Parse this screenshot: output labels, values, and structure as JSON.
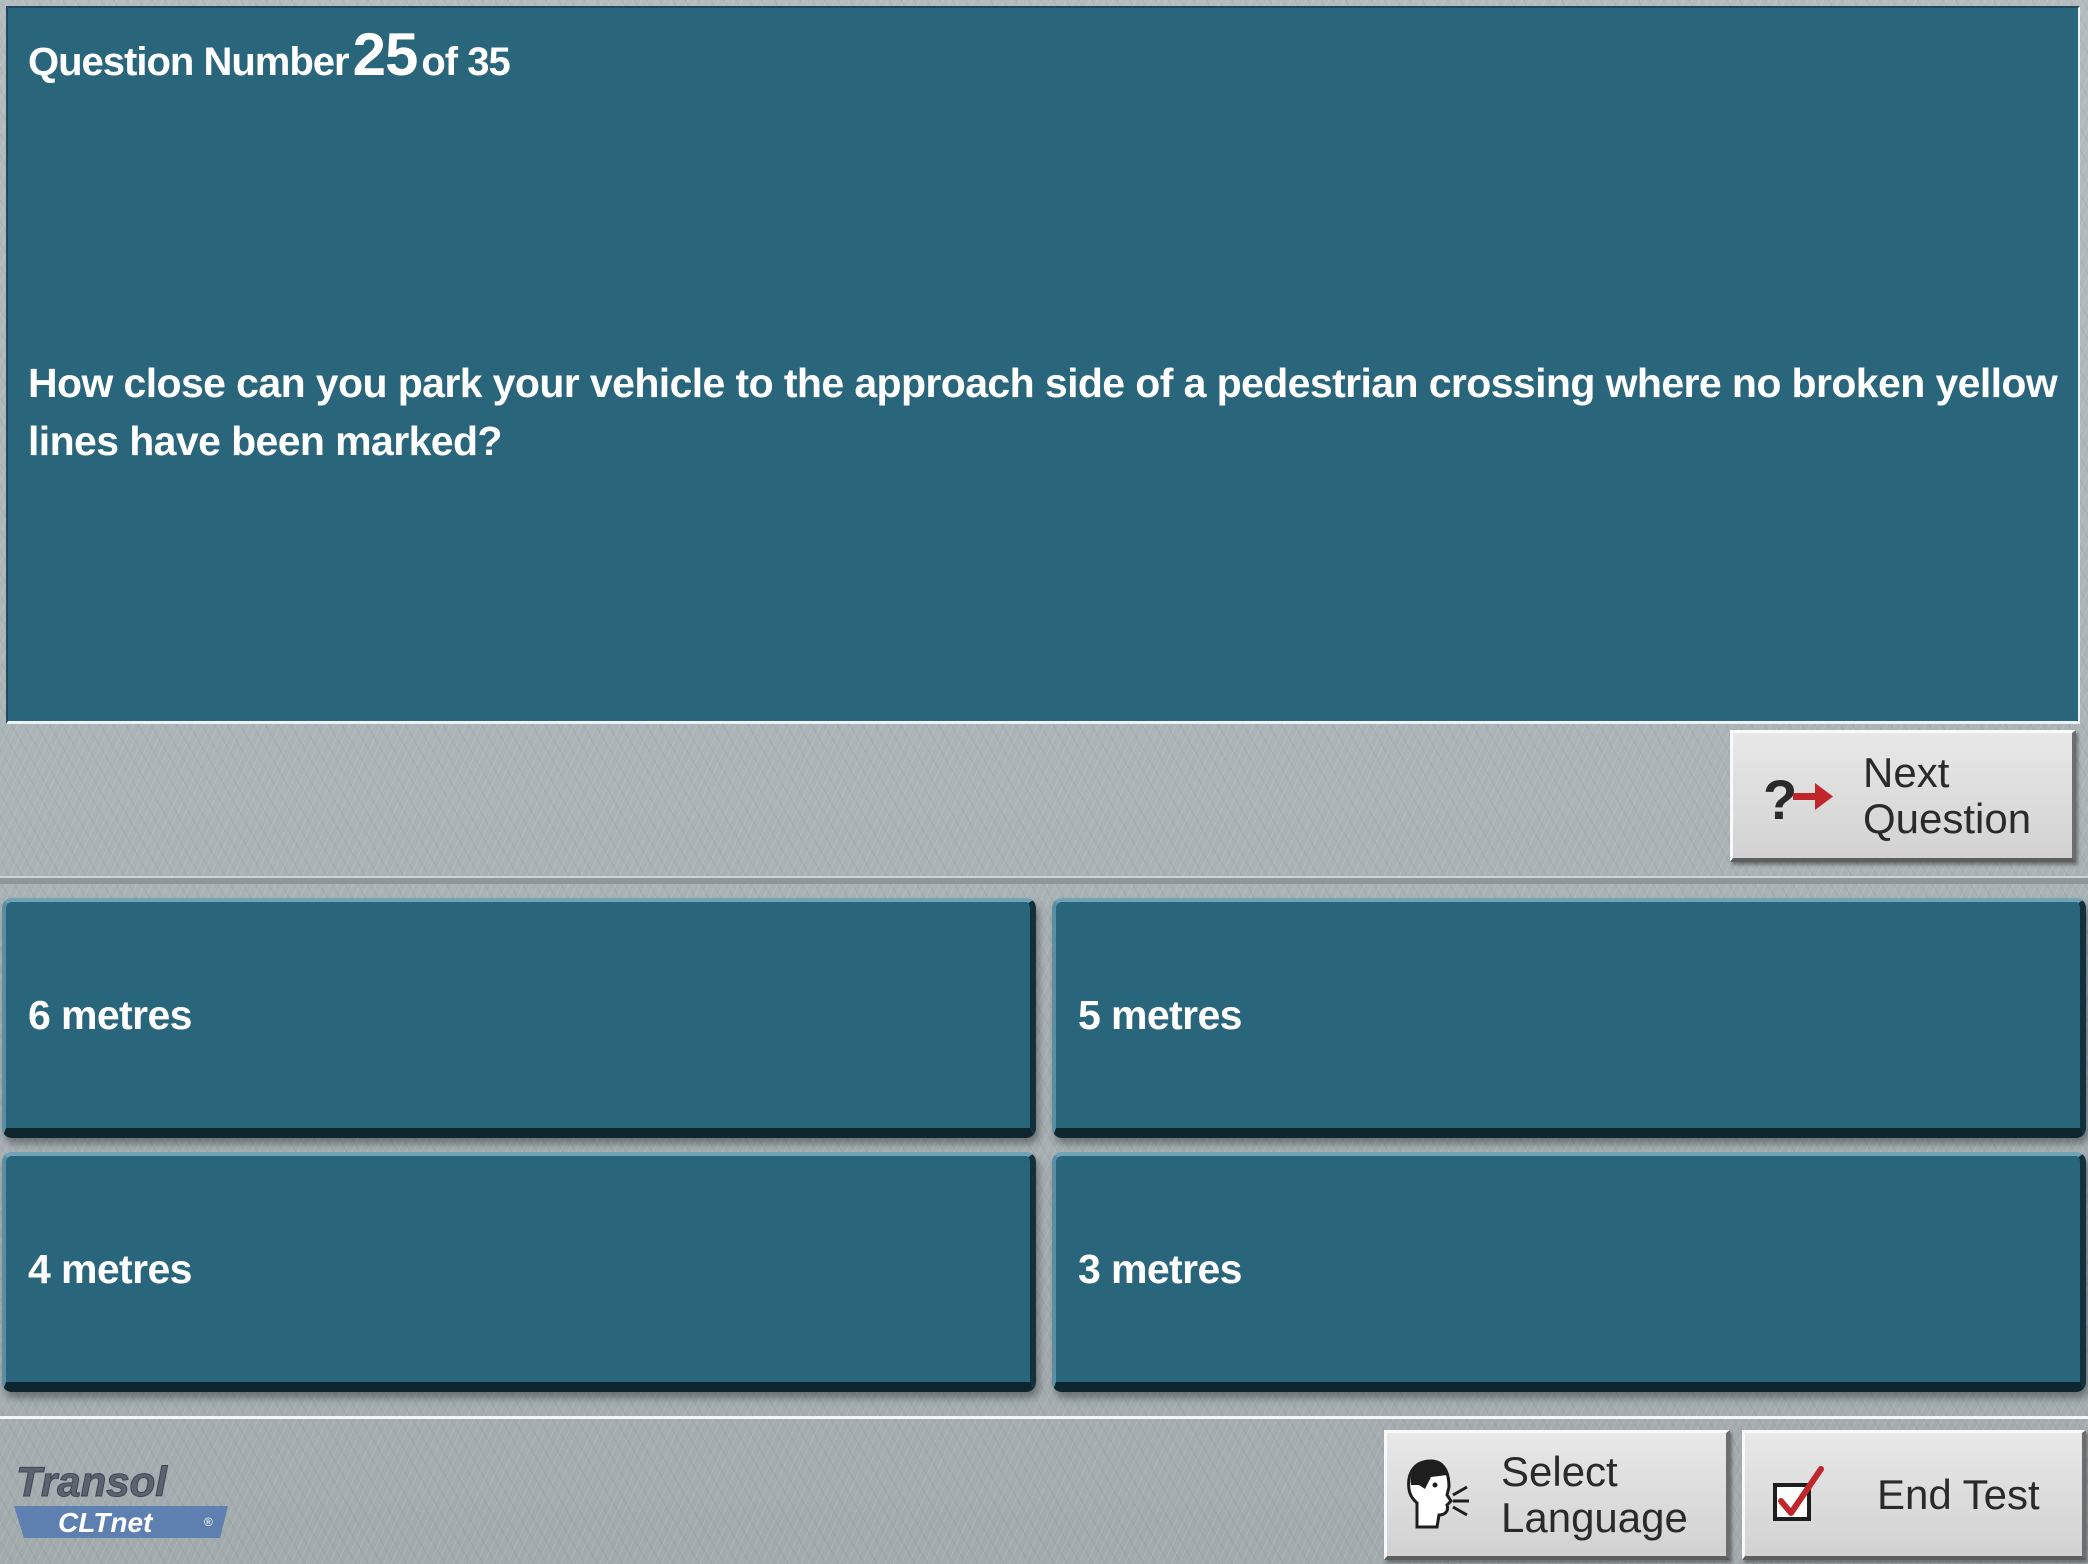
{
  "question": {
    "header_prefix": "Question Number",
    "number": "25",
    "header_suffix": "of 35",
    "text": "How close can you park your vehicle to the approach side of a pedestrian crossing where no broken yellow lines have been marked?"
  },
  "buttons": {
    "next_line1": "Next",
    "next_line2": "Question",
    "next_icon": "question-arrow-icon",
    "select_language_line1": "Select",
    "select_language_line2": "Language",
    "select_language_icon": "speaking-head-icon",
    "end_test": "End Test",
    "end_test_icon": "checkbox-check-icon"
  },
  "answers": [
    {
      "label": "6 metres"
    },
    {
      "label": "5 metres"
    },
    {
      "label": "4 metres"
    },
    {
      "label": "3 metres"
    }
  ],
  "logo": {
    "line1": "Transol",
    "line2": "CLTnet"
  },
  "colors": {
    "panel": "#29657b",
    "accent_red": "#c0272d",
    "logo_blue": "#5d80b0"
  }
}
